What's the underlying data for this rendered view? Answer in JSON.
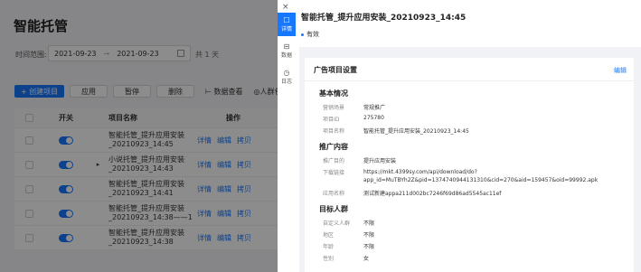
{
  "bg": {
    "title": "智能托管",
    "time_label": "时间范围:",
    "date_start": "2021-09-23",
    "date_sep": "→",
    "date_end": "2021-09-23",
    "days": "共 1 天",
    "toolbar": {
      "create": "+ 创建项目",
      "apply": "应用",
      "pause": "暂停",
      "delete": "删除",
      "data_view": "⊢ 数据查看",
      "crowd_pkg": "◎人群包打"
    },
    "table": {
      "headers": {
        "switch": "开关",
        "name": "项目名称",
        "ops": "操作"
      },
      "ops": {
        "detail": "详情",
        "edit": "编辑",
        "copy": "拷贝"
      },
      "rows": [
        {
          "name": "智能托管_提升应用安装_20210923_14:45",
          "expand": ""
        },
        {
          "name": "小说托管_提升应用安装_20210923_14:43",
          "expand": "▸"
        },
        {
          "name": "智能托管_提升应用安装_20210923_14:41",
          "expand": ""
        },
        {
          "name": "智能托管_提升应用安装_20210923_14:38——1",
          "expand": ""
        },
        {
          "name": "智能托管_提升应用安装_20210923_14:38",
          "expand": ""
        }
      ]
    }
  },
  "drawer": {
    "close": "×",
    "tabs": [
      {
        "icon": "☐",
        "label": "详情",
        "active": true
      },
      {
        "icon": "⊟",
        "label": "数据",
        "active": false
      },
      {
        "icon": "◷",
        "label": "日志",
        "active": false
      }
    ],
    "title": "智能托管_提升应用安装_20210923_14:45",
    "status": "有效",
    "card": {
      "title": "广告项目设置",
      "edit": "编辑",
      "basic": {
        "heading": "基本情况",
        "fields": [
          {
            "k": "营销场景",
            "v": "常规推广"
          },
          {
            "k": "项目ID",
            "v": "275780"
          },
          {
            "k": "项目名称",
            "v": "智能托管_提升应用安装_20210923_14:45"
          }
        ]
      },
      "promo": {
        "heading": "推广内容",
        "fields": [
          {
            "k": "推广目的",
            "v": "提升应用安装"
          },
          {
            "k": "下载链接",
            "v": "https://mkt.4399sy.com/api/download/do?app_id=MuTBYh2Z&pid=1374740944131310&cid=270&aid=159457&oid=99992.apk"
          },
          {
            "k": "应用名称",
            "v": "测试新建appa211d002bc7246f69d86ad5545ac11ef"
          }
        ]
      },
      "audience": {
        "heading": "目标人群",
        "fields": [
          {
            "k": "自定义人群",
            "v": "不限"
          },
          {
            "k": "地区",
            "v": "不限"
          },
          {
            "k": "年龄",
            "v": "不限"
          },
          {
            "k": "性别",
            "v": "女"
          }
        ]
      }
    }
  }
}
